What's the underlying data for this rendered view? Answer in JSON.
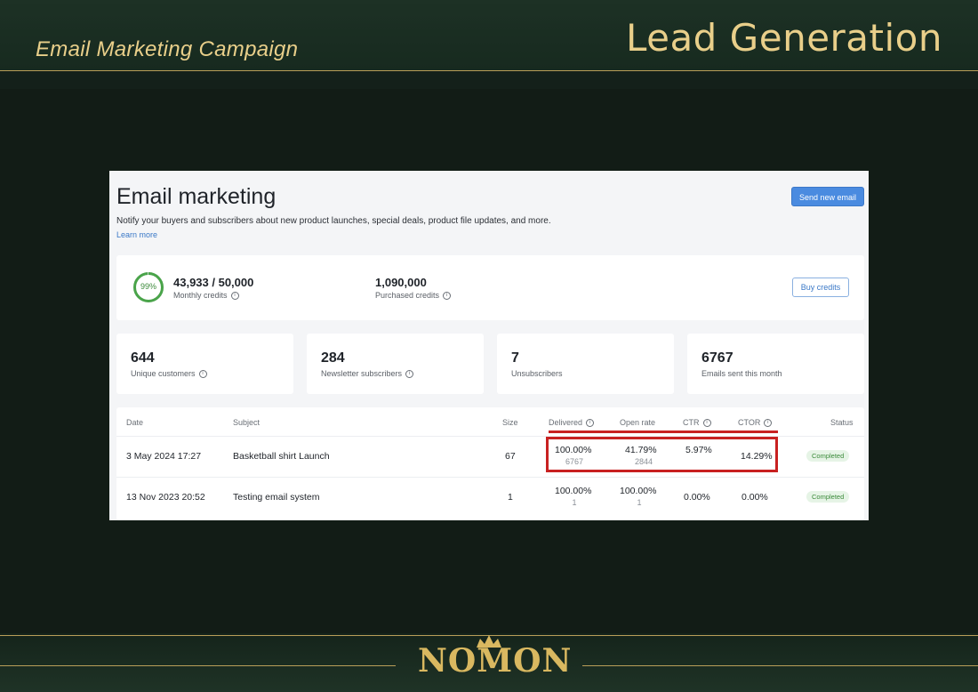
{
  "slide": {
    "subtitle": "Email Marketing Campaign",
    "title": "Lead Generation",
    "logo": "NOMON"
  },
  "screen": {
    "title": "Email marketing",
    "description": "Notify your buyers and subscribers about new product launches, special deals, product file updates, and more.",
    "learn_more": "Learn more",
    "send_button": "Send new email",
    "credits": {
      "percent_label": "99%",
      "percent": 0.99,
      "monthly_value": "43,933 / 50,000",
      "monthly_label": "Monthly credits",
      "purchased_value": "1,090,000",
      "purchased_label": "Purchased credits",
      "buy_button": "Buy credits"
    },
    "stats": [
      {
        "value": "644",
        "label": "Unique customers"
      },
      {
        "value": "284",
        "label": "Newsletter subscribers"
      },
      {
        "value": "7",
        "label": "Unsubscribers"
      },
      {
        "value": "6767",
        "label": "Emails sent this month"
      }
    ],
    "table": {
      "headers": [
        "Date",
        "Subject",
        "Size",
        "Delivered",
        "Open rate",
        "CTR",
        "CTOR",
        "Status"
      ],
      "rows": [
        {
          "date": "3 May 2024 17:27",
          "subject": "Basketball shirt Launch",
          "size": "67",
          "delivered": "100.00%",
          "delivered_count": "6767",
          "open_rate": "41.79%",
          "open_count": "2844",
          "ctr": "5.97%",
          "ctor": "14.29%",
          "status": "Completed"
        },
        {
          "date": "13 Nov 2023 20:52",
          "subject": "Testing email system",
          "size": "1",
          "delivered": "100.00%",
          "delivered_count": "1",
          "open_rate": "100.00%",
          "open_count": "1",
          "ctr": "0.00%",
          "ctor": "0.00%",
          "status": "Completed"
        }
      ]
    }
  },
  "colors": {
    "accent_gold": "#e9cf8a",
    "primary_blue": "#4a8be0",
    "success_green": "#3b8a3a",
    "highlight_red": "#c82121"
  }
}
